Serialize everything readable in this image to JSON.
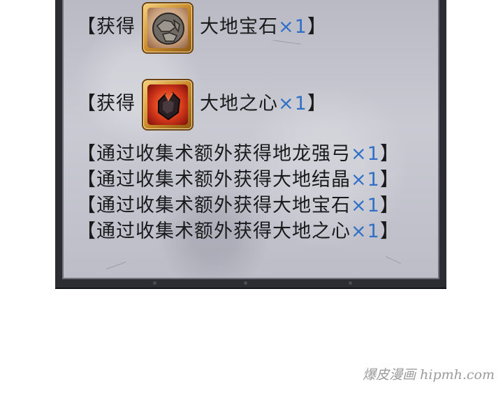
{
  "rewards": [
    {
      "bracket_open": "【",
      "label": "获得",
      "item": "大地宝石",
      "qty": "×1",
      "bracket_close": "】",
      "icon": "earth-gem-icon"
    },
    {
      "bracket_open": "【",
      "label": "获得",
      "item": "大地之心",
      "qty": "×1",
      "bracket_close": "】",
      "icon": "earth-heart-icon"
    }
  ],
  "bonus_lines": [
    {
      "bracket_open": "【",
      "text": "通过收集术额外获得地龙强弓",
      "qty": "×1",
      "bracket_close": "】"
    },
    {
      "bracket_open": "【",
      "text": "通过收集术额外获得大地结晶",
      "qty": "×1",
      "bracket_close": "】"
    },
    {
      "bracket_open": "【",
      "text": "通过收集术额外获得大地宝石",
      "qty": "×1",
      "bracket_close": "】"
    },
    {
      "bracket_open": "【",
      "text": "通过收集术额外获得大地之心",
      "qty": "×1",
      "bracket_close": "】"
    }
  ],
  "watermark": "爆皮漫画 hipmh.com",
  "colors": {
    "panel_frame": "#2b2d33",
    "panel_stone": "#c2c3cc",
    "text": "#1a1a1d",
    "quantity": "#2f6fc7",
    "icon_frame": "#c98a2a"
  }
}
